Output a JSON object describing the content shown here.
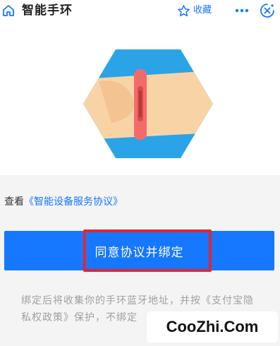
{
  "header": {
    "title": "智能手环",
    "favorite_label": "收藏",
    "accent_color": "#1677ff",
    "icons": [
      "home-icon",
      "star-icon",
      "more-icon",
      "close-icon"
    ]
  },
  "illustration": {
    "description_icon": "smart-band-on-wrist-icon",
    "colors": {
      "hexagon": "#2aa4e6",
      "hand": "#f8d3a6",
      "band": "#f26b6b"
    }
  },
  "agreement": {
    "prefix": "查看",
    "link_text": "《智能设备服务协议》"
  },
  "bind_button": {
    "label": "同意协议并绑定",
    "color": "#1677ff",
    "highlight_color": "#e02633"
  },
  "note": {
    "line1": "绑定后将收集你的手环蓝牙地址，并按《支付宝隐",
    "line2": "私权政策》保护，不绑定"
  },
  "watermark": {
    "text": "CooZhi.Com"
  }
}
